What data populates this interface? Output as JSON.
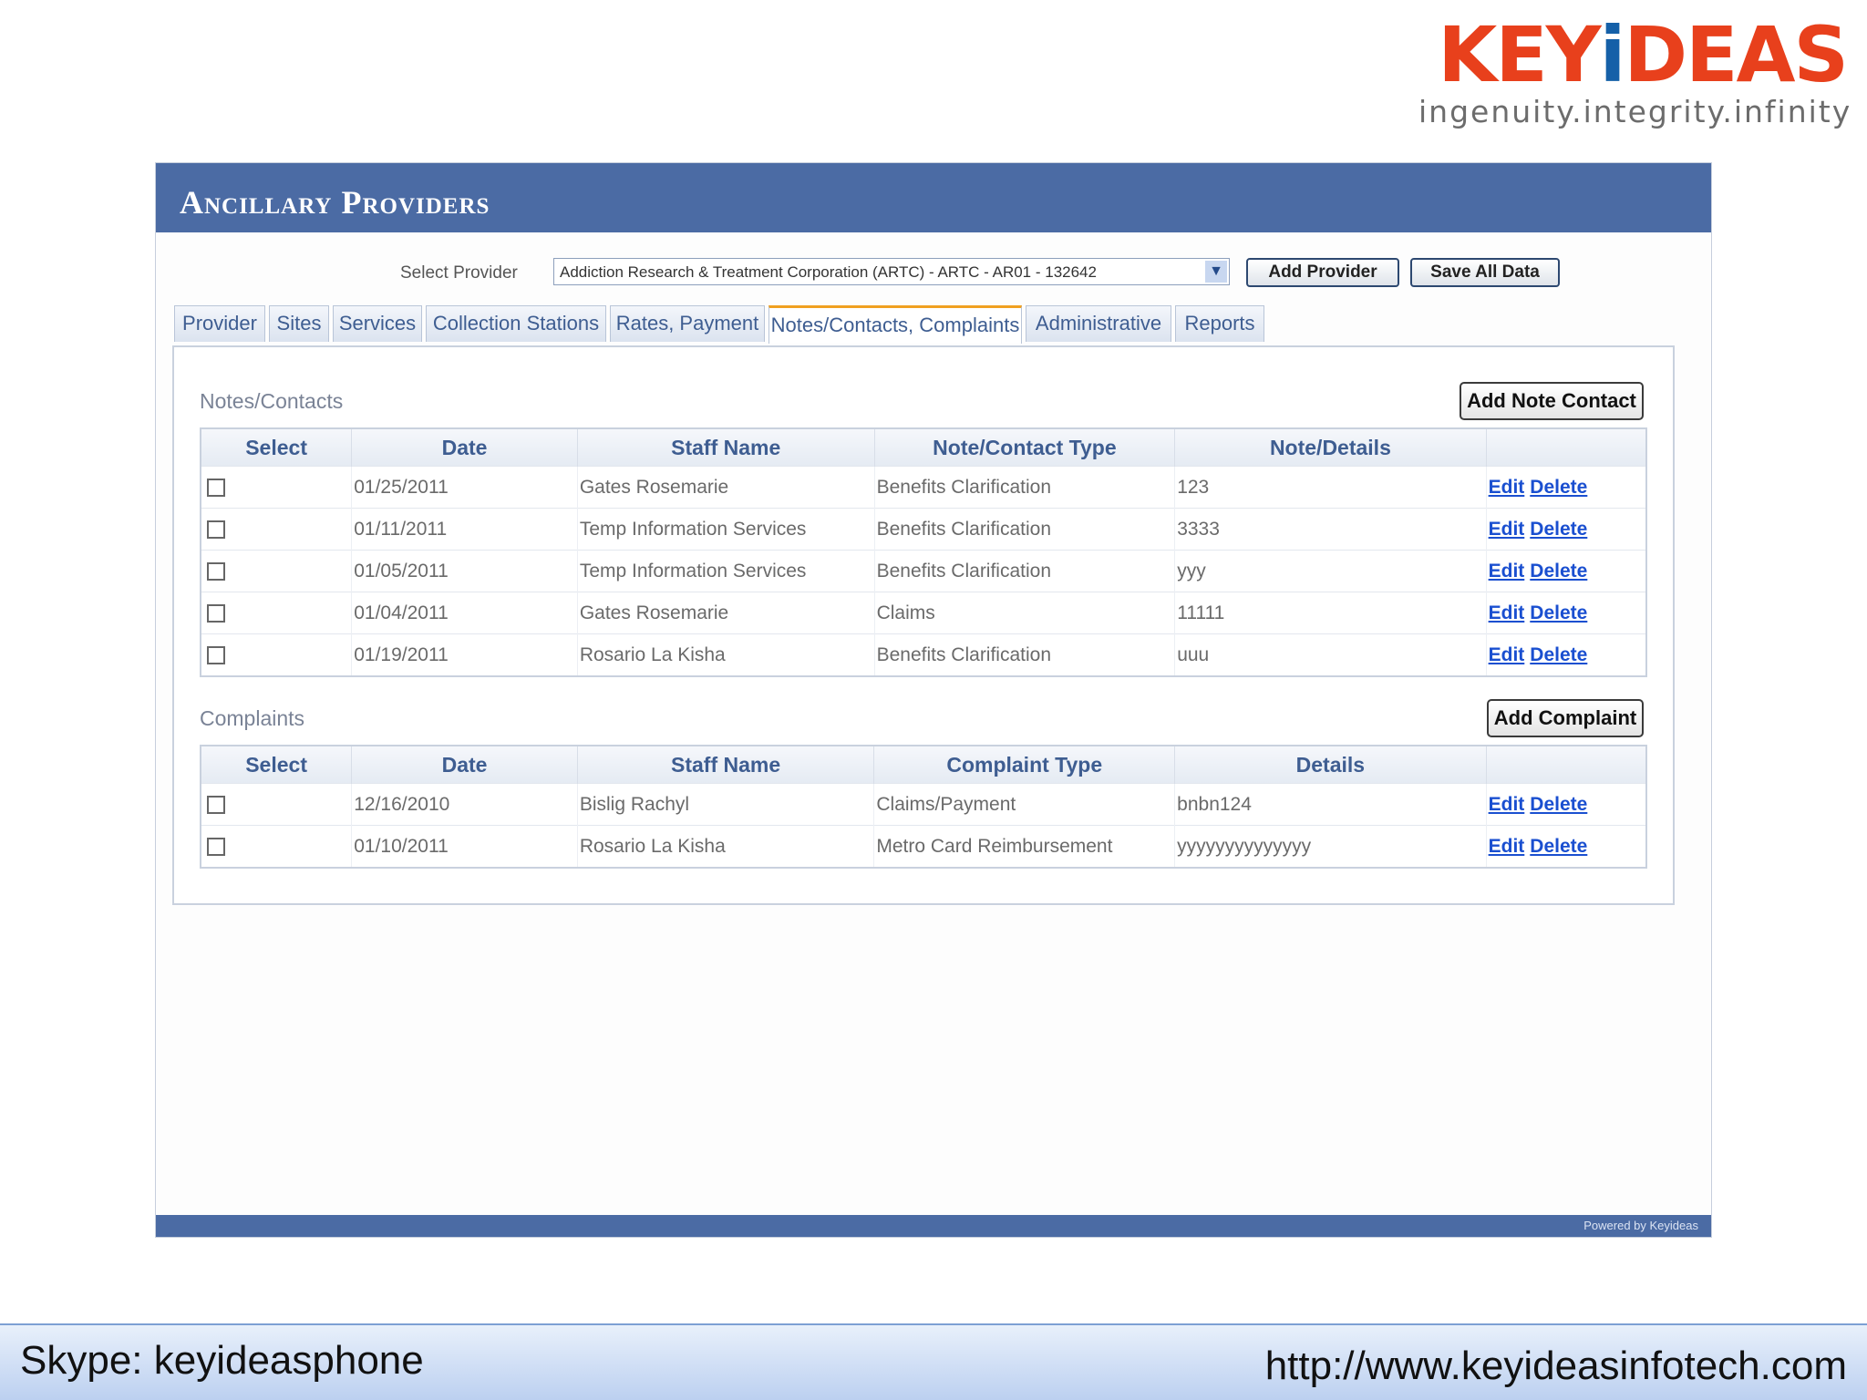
{
  "logo": {
    "part1": "KEY",
    "part2": "i",
    "part3": "DEAS",
    "tagline": "ingenuity.integrity.infinity"
  },
  "app": {
    "title": "Ancillary Providers",
    "select_provider_label": "Select Provider",
    "selected_provider": "Addiction Research & Treatment Corporation (ARTC) - ARTC - AR01 - 132642",
    "add_provider_label": "Add Provider",
    "save_all_label": "Save All Data",
    "powered_by": "Powered by Keyideas"
  },
  "tabs": [
    {
      "label": "Provider"
    },
    {
      "label": "Sites"
    },
    {
      "label": "Services"
    },
    {
      "label": "Collection Stations"
    },
    {
      "label": "Rates, Payment"
    },
    {
      "label": "Notes/Contacts, Complaints",
      "active": true
    },
    {
      "label": "Administrative"
    },
    {
      "label": "Reports"
    }
  ],
  "notes": {
    "title": "Notes/Contacts",
    "add_label": "Add Note Contact",
    "columns": [
      "Select",
      "Date",
      "Staff Name",
      "Note/Contact Type",
      "Note/Details",
      ""
    ],
    "rows": [
      {
        "date": "01/25/2011",
        "staff": "Gates Rosemarie",
        "type": "Benefits Clarification",
        "details": "123"
      },
      {
        "date": "01/11/2011",
        "staff": "Temp Information Services",
        "type": "Benefits Clarification",
        "details": "3333"
      },
      {
        "date": "01/05/2011",
        "staff": "Temp Information Services",
        "type": "Benefits Clarification",
        "details": "yyy"
      },
      {
        "date": "01/04/2011",
        "staff": "Gates Rosemarie",
        "type": "Claims",
        "details": "11111"
      },
      {
        "date": "01/19/2011",
        "staff": "Rosario La Kisha",
        "type": "Benefits Clarification",
        "details": "uuu"
      }
    ]
  },
  "complaints": {
    "title": "Complaints",
    "add_label": "Add Complaint",
    "columns": [
      "Select",
      "Date",
      "Staff Name",
      "Complaint Type",
      "Details",
      ""
    ],
    "rows": [
      {
        "date": "12/16/2010",
        "staff": "Bislig Rachyl",
        "type": "Claims/Payment",
        "details": "bnbn124"
      },
      {
        "date": "01/10/2011",
        "staff": "Rosario La Kisha",
        "type": "Metro Card Reimbursement",
        "details": "yyyyyyyyyyyyyy"
      }
    ]
  },
  "row_actions": {
    "edit": "Edit",
    "delete": "Delete"
  },
  "footer": {
    "skype": "Skype: keyideasphone",
    "website": "http://www.keyideasinfotech.com"
  },
  "colors": {
    "header_bg": "#4b6ba4",
    "logo_red": "#e8401c",
    "logo_blue": "#1560a8",
    "link": "#1a4fd0",
    "active_tab_accent": "#f0a020"
  }
}
